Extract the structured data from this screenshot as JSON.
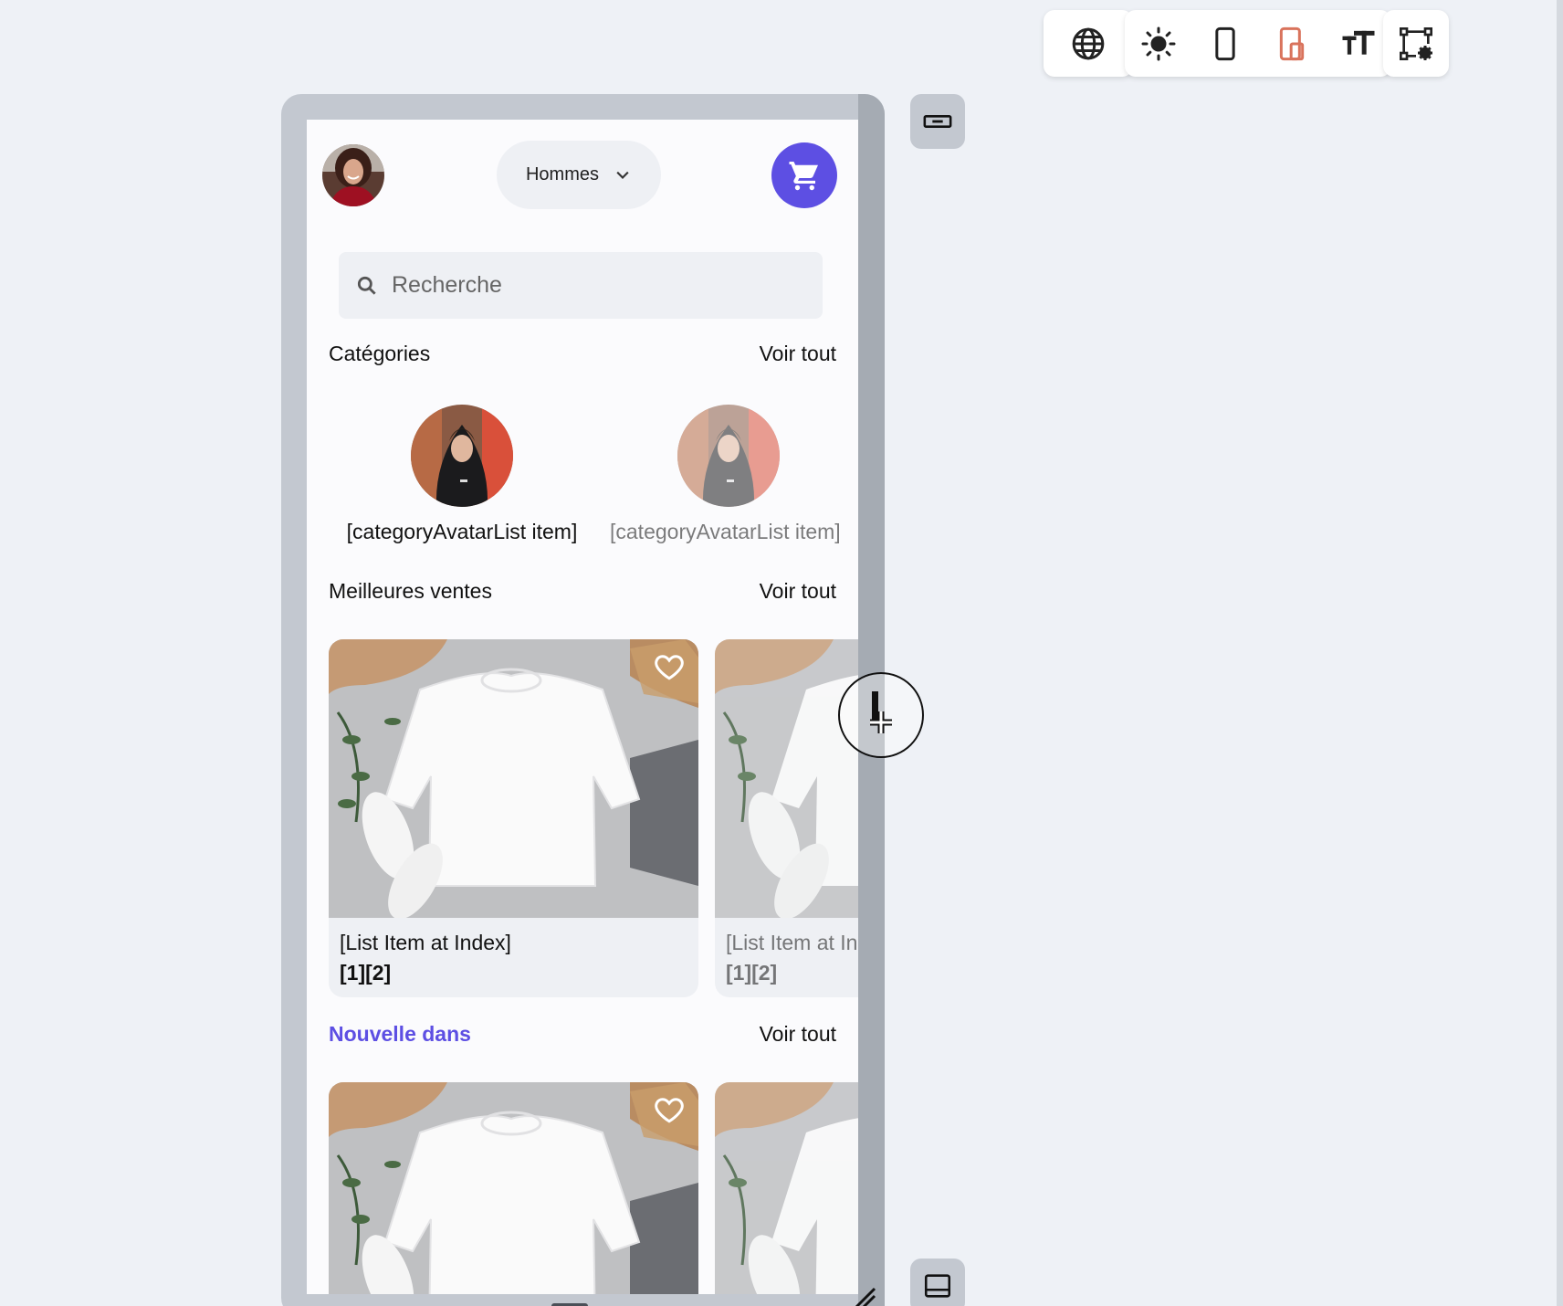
{
  "toolbar": {
    "icons": [
      "globe-icon",
      "sun-icon",
      "phone-icon",
      "tablet-icon",
      "text-size-icon",
      "layout-settings-icon"
    ],
    "accent_color": "#d9735c"
  },
  "app": {
    "gender_select": {
      "value": "Hommes"
    },
    "search": {
      "placeholder": "Recherche"
    },
    "categories": {
      "title": "Catégories",
      "see_all": "Voir tout",
      "items": [
        {
          "label": "[categoryAvatarList item]"
        },
        {
          "label": "[categoryAvatarList item]"
        }
      ]
    },
    "best_sellers": {
      "title": "Meilleures ventes",
      "see_all": "Voir tout",
      "items": [
        {
          "name": "[List Item at Index]",
          "price": "[1][2]"
        },
        {
          "name": "[List Item at Index]",
          "price": "[1][2]"
        }
      ]
    },
    "new_in": {
      "title": "Nouvelle dans",
      "see_all": "Voir tout"
    },
    "colors": {
      "primary": "#5d4fe3",
      "surface": "#eef0f4"
    }
  }
}
